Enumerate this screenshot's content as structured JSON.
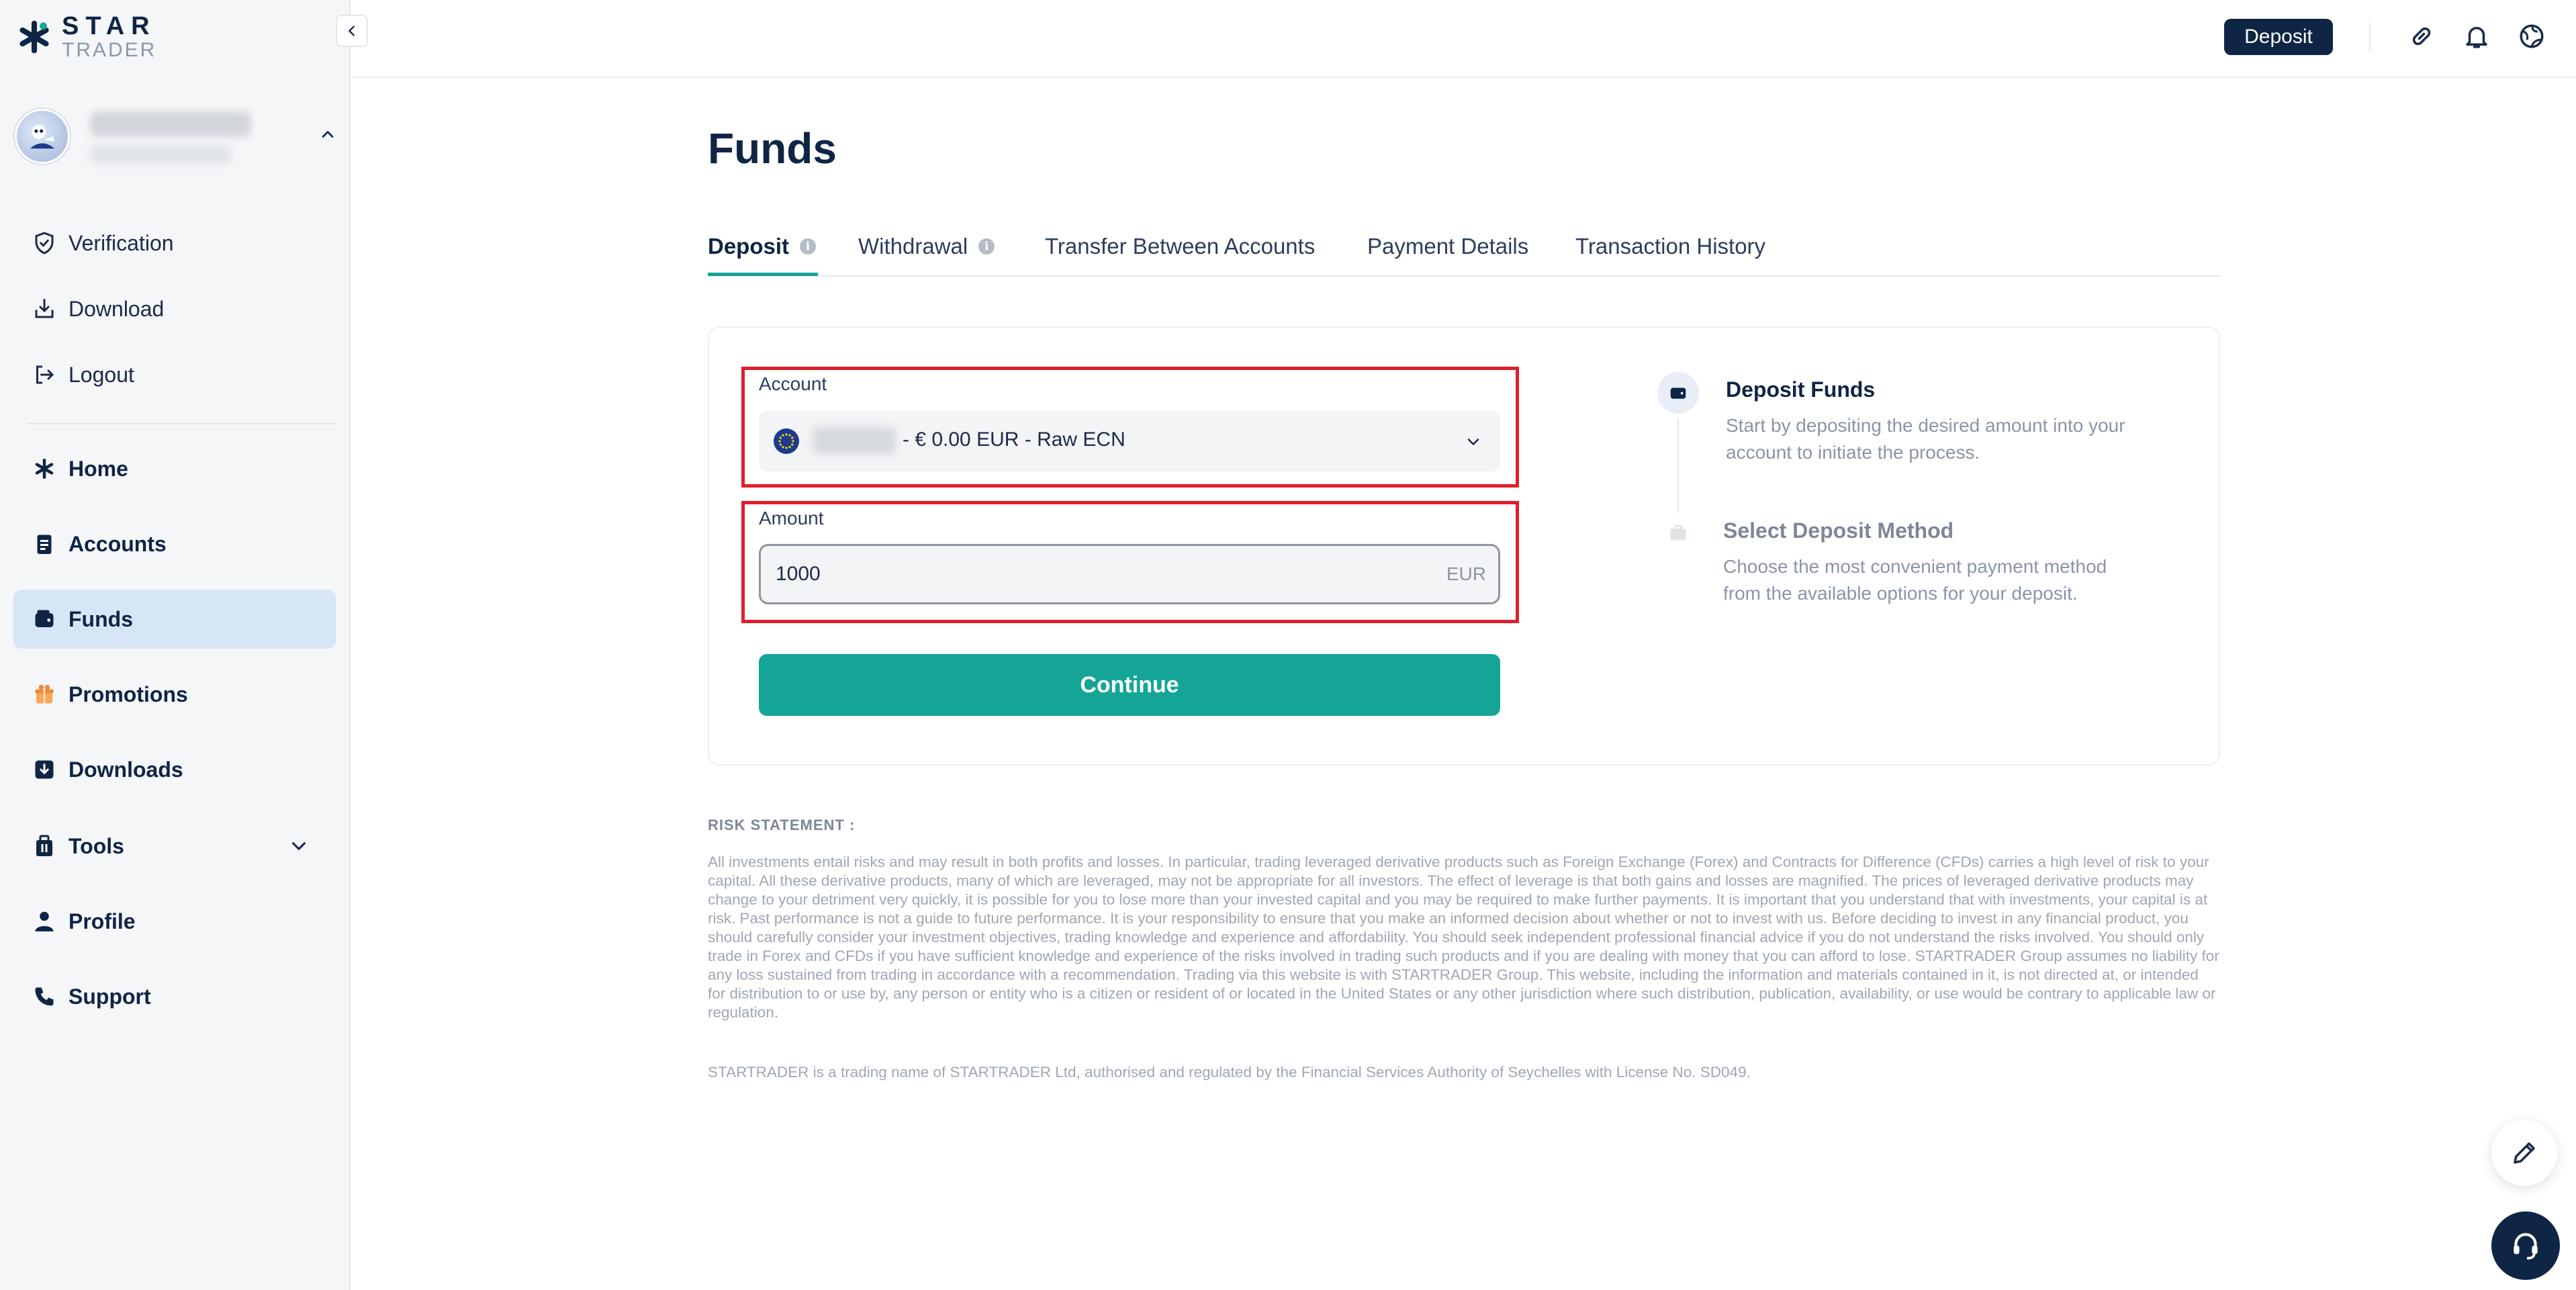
{
  "brand": {
    "name_top": "STAR",
    "name_bottom": "TRADER"
  },
  "sidebar": {
    "menu_top": [
      {
        "label": "Verification",
        "icon": "shield-check-icon"
      },
      {
        "label": "Download",
        "icon": "download-tray-icon"
      },
      {
        "label": "Logout",
        "icon": "logout-icon"
      }
    ],
    "menu_main": [
      {
        "label": "Home",
        "icon": "star-icon"
      },
      {
        "label": "Accounts",
        "icon": "clipboard-icon"
      },
      {
        "label": "Funds",
        "icon": "wallet-icon",
        "active": true
      },
      {
        "label": "Promotions",
        "icon": "gift-icon"
      },
      {
        "label": "Downloads",
        "icon": "download-box-icon"
      },
      {
        "label": "Tools",
        "icon": "toolbox-icon"
      },
      {
        "label": "Profile",
        "icon": "person-icon"
      },
      {
        "label": "Support",
        "icon": "phone-icon"
      }
    ]
  },
  "topbar": {
    "deposit_label": "Deposit"
  },
  "main": {
    "title": "Funds",
    "tabs": [
      {
        "label": "Deposit",
        "active": true,
        "info": true
      },
      {
        "label": "Withdrawal",
        "info": true
      },
      {
        "label": "Transfer Between Accounts"
      },
      {
        "label": "Payment Details"
      },
      {
        "label": "Transaction History"
      }
    ],
    "form": {
      "account_label": "Account",
      "account_value": "- € 0.00 EUR - Raw ECN",
      "amount_label": "Amount",
      "amount_value": "1000",
      "amount_unit": "EUR",
      "continue_label": "Continue"
    },
    "steps": [
      {
        "title": "Deposit Funds",
        "desc": "Start by depositing the desired amount into your account to initiate the process."
      },
      {
        "title": "Select Deposit Method",
        "desc": "Choose the most convenient payment method from the available options for your deposit."
      }
    ],
    "risk_title": "RISK STATEMENT :",
    "risk_text": "All investments entail risks and may result in both profits and losses. In particular, trading leveraged derivative products such as Foreign Exchange (Forex) and Contracts for Difference (CFDs) carries a high level of risk to your capital. All these derivative products, many of which are leveraged, may not be appropriate for all investors. The effect of leverage is that both gains and losses are magnified. The prices of leveraged derivative products may change to your detriment very quickly, it is possible for you to lose more than your invested capital and you may be required to make further payments. It is important that you understand that with investments, your capital is at risk. Past performance is not a guide to future performance. It is your responsibility to ensure that you make an informed decision about whether or not to invest with us. Before deciding to invest in any financial product, you should carefully consider your investment objectives, trading knowledge and experience and affordability. You should seek independent professional financial advice if you do not understand the risks involved. You should only trade in Forex and CFDs if you have sufficient knowledge and experience of the risks involved in trading such products and if you are dealing with money that you can afford to lose. STARTRADER Group assumes no liability for any loss sustained from trading in accordance with a recommendation. Trading via this website is with STARTRADER Group. This website, including the information and materials contained in it, is not directed at, or intended for distribution to or use by, any person or entity who is a citizen or resident of or located in the United States or any other jurisdiction where such distribution, publication, availability, or use would be contrary to applicable law or regulation.",
    "license_text": "STARTRADER is a trading name of STARTRADER Ltd, authorised and regulated by the Financial Services Authority of Seychelles with License No. SD049."
  },
  "colors": {
    "accent": "#14a597",
    "navy": "#0f2545",
    "highlight": "#e01e2b",
    "active_bg": "#d7e6f7"
  }
}
